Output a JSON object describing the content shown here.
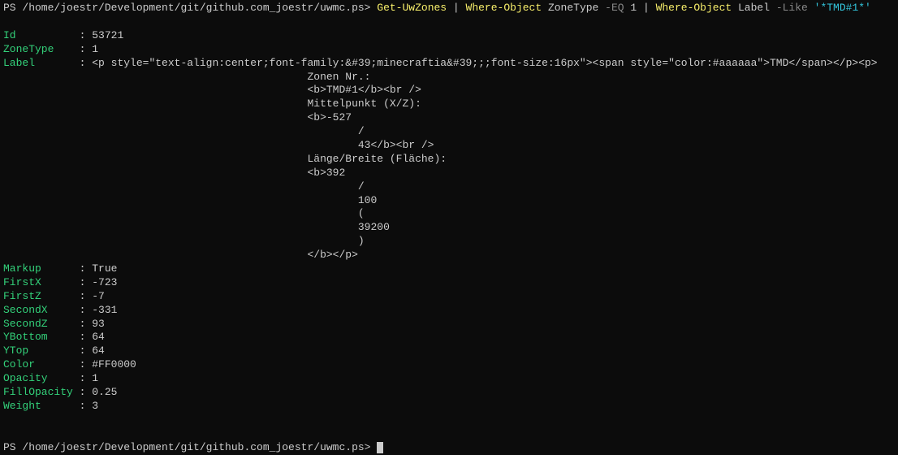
{
  "prompt1": {
    "ps": "PS ",
    "path": "/home/joestr/Development/git/github.com_joestr/uwmc.ps> ",
    "cmd1": "Get-UwZones",
    "pipe1": " | ",
    "cmd2": "Where-Object",
    "arg2a": " ZoneType ",
    "op2": "-EQ",
    "arg2b": " 1",
    "pipe2": " | ",
    "cmd3": "Where-Object",
    "arg3a": " Label ",
    "op3": "-Like",
    "arg3b_space": " ",
    "arg3b": "'*TMD#1*'"
  },
  "rows": {
    "id": {
      "k": "Id         ",
      "s": " : ",
      "v": "53721"
    },
    "zonetype": {
      "k": "ZoneType   ",
      "s": " : ",
      "v": "1"
    },
    "label": {
      "k": "Label      ",
      "s": " : ",
      "v": "<p style=\"text-align:center;font-family:&#39;minecraftia&#39;;;font-size:16px\"><span style=\"color:#aaaaaa\">TMD</span></p><p>"
    },
    "l02": "                                                Zonen Nr.:",
    "l03": "                                                <b>TMD#1</b><br />",
    "l04": "                                                Mittelpunkt (X/Z):",
    "l05": "                                                <b>-527",
    "l06": "                                                        /",
    "l07": "                                                        43</b><br />",
    "l08": "                                                Länge/Breite (Fläche):",
    "l09": "                                                <b>392",
    "l10": "                                                        /",
    "l11": "                                                        100",
    "l12": "                                                        (",
    "l13": "                                                        39200",
    "l14": "                                                        )",
    "l15": "                                                </b></p>",
    "markup": {
      "k": "Markup     ",
      "s": " : ",
      "v": "True"
    },
    "firstx": {
      "k": "FirstX     ",
      "s": " : ",
      "v": "-723"
    },
    "firstz": {
      "k": "FirstZ     ",
      "s": " : ",
      "v": "-7"
    },
    "secondx": {
      "k": "SecondX    ",
      "s": " : ",
      "v": "-331"
    },
    "secondz": {
      "k": "SecondZ    ",
      "s": " : ",
      "v": "93"
    },
    "ybottom": {
      "k": "YBottom    ",
      "s": " : ",
      "v": "64"
    },
    "ytop": {
      "k": "YTop       ",
      "s": " : ",
      "v": "64"
    },
    "color": {
      "k": "Color      ",
      "s": " : ",
      "v": "#FF0000"
    },
    "opacity": {
      "k": "Opacity    ",
      "s": " : ",
      "v": "1"
    },
    "fillopacity": {
      "k": "FillOpacity",
      "s": " : ",
      "v": "0.25"
    },
    "weight": {
      "k": "Weight     ",
      "s": " : ",
      "v": "3"
    }
  },
  "prompt2": {
    "ps": "PS ",
    "path": "/home/joestr/Development/git/github.com_joestr/uwmc.ps> "
  }
}
